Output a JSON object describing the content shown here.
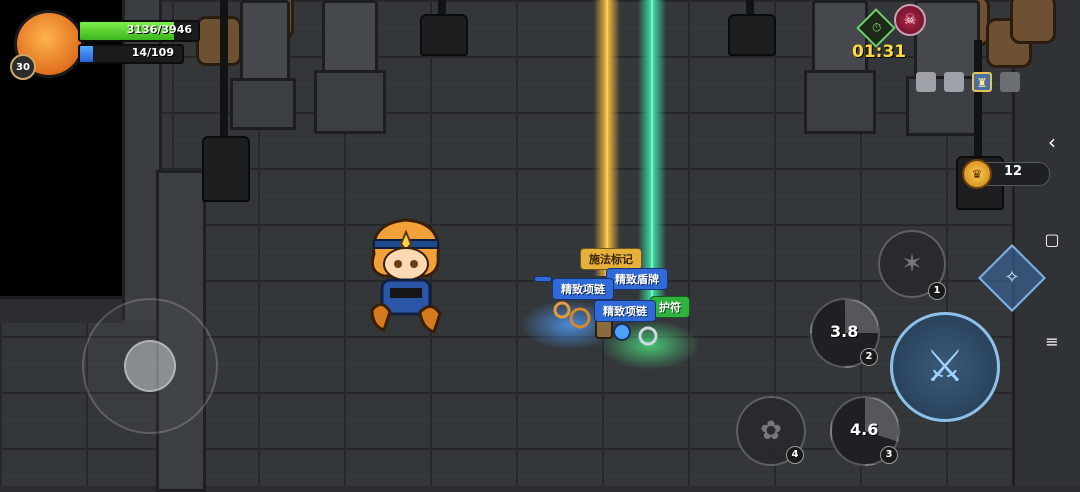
{
  "player": {
    "level": "30",
    "hp_text": "3136/3946",
    "hp_fraction": 0.795,
    "energy_text": "14/109",
    "energy_fraction": 0.128
  },
  "timer": {
    "text": "01:31"
  },
  "coins": {
    "count": "12"
  },
  "loot_labels": [
    {
      "text": "施法标记",
      "style": "gold"
    },
    {
      "text": "精致盾牌",
      "style": "blue"
    },
    {
      "text": "精致项链",
      "style": "blue"
    },
    {
      "text": "精致项链",
      "style": "blue"
    },
    {
      "text": "护符",
      "style": "green"
    }
  ],
  "skills": {
    "skill_1": {
      "number": "1"
    },
    "skill_2": {
      "number": "2",
      "cooldown": "3.8"
    },
    "skill_3": {
      "number": "3",
      "cooldown": "4.6"
    },
    "skill_4": {
      "number": "4"
    }
  },
  "icons": {
    "attack": "sword-icon",
    "boss": "boss-skull-icon",
    "timer": "stopwatch-icon",
    "coin": "crown-coin-icon",
    "collapse": "chevron-left-icon"
  },
  "colors": {
    "hp": "#39b51e",
    "energy": "#2a62d8",
    "timer": "#ffd83a",
    "gold_beam": "#ffbe3c",
    "green_beam": "#3ce6aa"
  }
}
